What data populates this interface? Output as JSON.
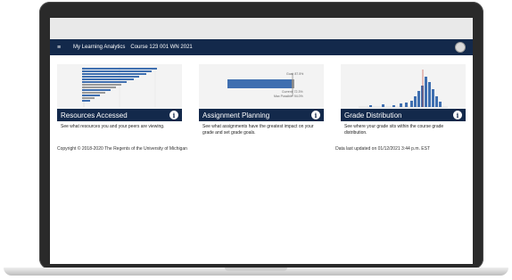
{
  "app": {
    "title": "My Learning Analytics",
    "course": "Course 123 001 WN 2021",
    "menu_glyph": "≡"
  },
  "cards": [
    {
      "title": "Resources Accessed",
      "desc": "See what resources you and your peers are viewing."
    },
    {
      "title": "Assignment Planning",
      "desc": "See what assignments have the greatest impact on your grade and set grade goals."
    },
    {
      "title": "Grade Distribution",
      "desc": "See where your grade sits within the course grade distribution."
    }
  ],
  "info_glyph": "i",
  "footer": {
    "copyright": "Copyright © 2018-2020 The Regents of the University of Michigan",
    "updated": "Data last updated on 01/12/2021 3:44 p.m. EST"
  },
  "thumb_planning": {
    "goal": "Goal: 87.5%",
    "current": "Current: 72.3%",
    "max": "Max Possible: 94.0%"
  },
  "colors": {
    "navy": "#13294b",
    "bar_blue": "#3f6fb0",
    "bar_gray": "#9a9a9a"
  }
}
